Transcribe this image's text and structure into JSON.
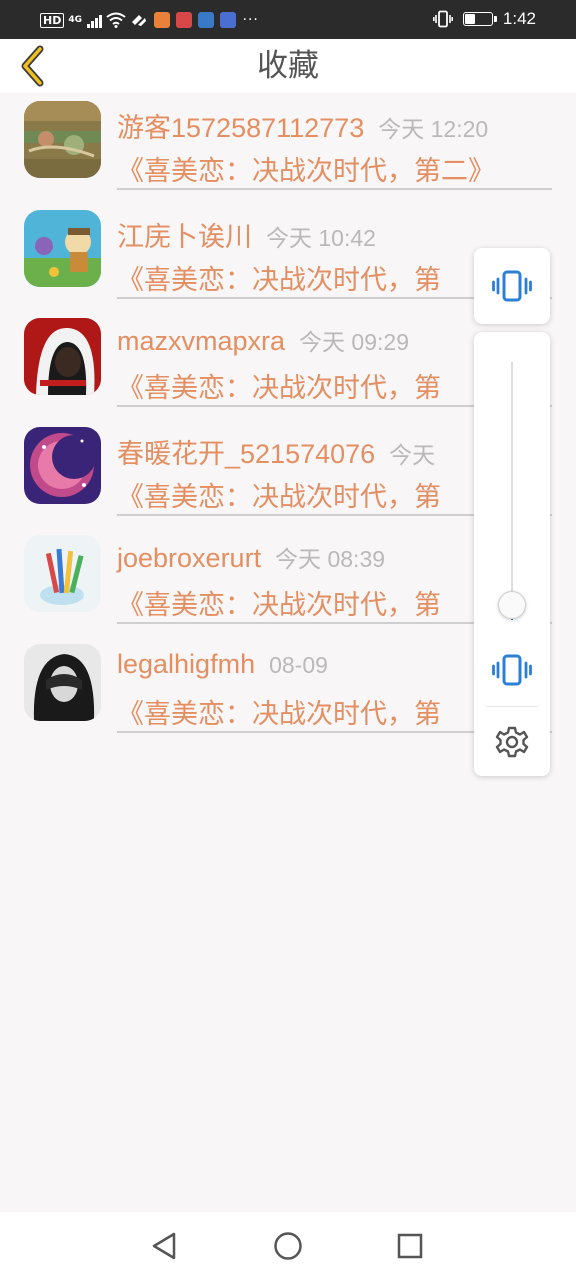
{
  "status_bar": {
    "hd": "HD",
    "network": "4G",
    "more": "···",
    "time": "1:42",
    "battery_level": 0.35,
    "app_icon_colors": [
      "#e9813a",
      "#d94848",
      "#3a78c8",
      "#4a6fd1"
    ]
  },
  "header": {
    "title": "收藏",
    "back_icon": "chevron-left-icon",
    "back_color": "#f0c020"
  },
  "accent_color": "#e48f62",
  "time_color": "#b9b9b9",
  "favorites": [
    {
      "name": "游客1572587112773",
      "time": "今天 12:20",
      "content": "《喜美恋：决战次时代，第二》"
    },
    {
      "name": "江庑卜诶川",
      "time": "今天 10:42",
      "content": "《喜美恋：决战次时代，第"
    },
    {
      "name": "mazxvmapxra",
      "time": "今天 09:29",
      "content": "《喜美恋：决战次时代，第"
    },
    {
      "name": "春暖花开_521574076",
      "time": "今天",
      "content": "《喜美恋：决战次时代，第"
    },
    {
      "name": "joebroxerurt",
      "time": "今天 08:39",
      "content": "《喜美恋：决战次时代，第"
    },
    {
      "name": "legalhigfmh",
      "time": "08-09",
      "content": "《喜美恋：决战次时代，第"
    }
  ],
  "volume_panel": {
    "level": 0.06,
    "vibrate_icon": "vibrate-icon",
    "settings_icon": "gear-icon",
    "icon_color": "#2b7fd6"
  },
  "navbar": {
    "back_icon": "triangle-back-icon",
    "home_icon": "circle-home-icon",
    "recents_icon": "square-recents-icon"
  }
}
